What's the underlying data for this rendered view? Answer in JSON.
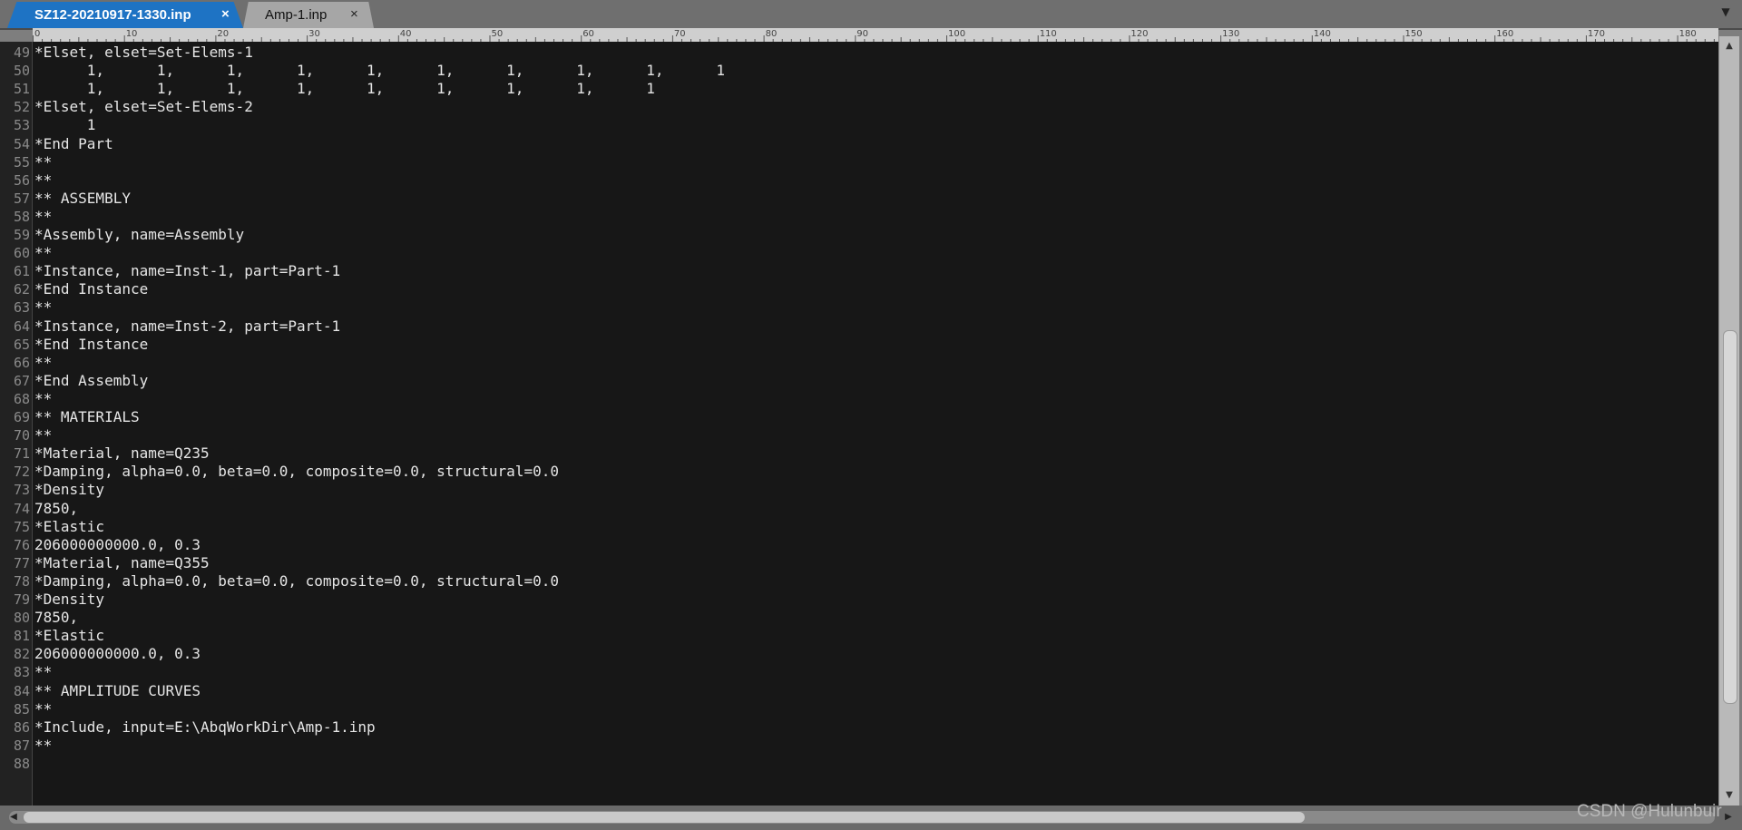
{
  "tabs": [
    {
      "label": "SZ12-20210917-1330.inp",
      "close": "×",
      "active": true
    },
    {
      "label": "Amp-1.inp",
      "close": "×",
      "active": false
    }
  ],
  "tab_menu_icon": "chevron-down-icon",
  "ruler": {
    "labels": [
      "0",
      "10",
      "20",
      "30",
      "40",
      "50",
      "60",
      "70",
      "80",
      "90",
      "100",
      "110",
      "120",
      "130",
      "140",
      "150",
      "160",
      "170",
      "180"
    ]
  },
  "lines": [
    {
      "n": "49",
      "text": "*Elset, elset=Set-Elems-1"
    },
    {
      "n": "50",
      "text": "      1,      1,      1,      1,      1,      1,      1,      1,      1,      1"
    },
    {
      "n": "51",
      "text": "      1,      1,      1,      1,      1,      1,      1,      1,      1"
    },
    {
      "n": "52",
      "text": "*Elset, elset=Set-Elems-2"
    },
    {
      "n": "53",
      "text": "      1"
    },
    {
      "n": "54",
      "text": "*End Part"
    },
    {
      "n": "55",
      "text": "**"
    },
    {
      "n": "56",
      "text": "**"
    },
    {
      "n": "57",
      "text": "** ASSEMBLY"
    },
    {
      "n": "58",
      "text": "**"
    },
    {
      "n": "59",
      "text": "*Assembly, name=Assembly"
    },
    {
      "n": "60",
      "text": "**"
    },
    {
      "n": "61",
      "text": "*Instance, name=Inst-1, part=Part-1"
    },
    {
      "n": "62",
      "text": "*End Instance"
    },
    {
      "n": "63",
      "text": "**"
    },
    {
      "n": "64",
      "text": "*Instance, name=Inst-2, part=Part-1"
    },
    {
      "n": "65",
      "text": "*End Instance"
    },
    {
      "n": "66",
      "text": "**"
    },
    {
      "n": "67",
      "text": "*End Assembly"
    },
    {
      "n": "68",
      "text": "**"
    },
    {
      "n": "69",
      "text": "** MATERIALS"
    },
    {
      "n": "70",
      "text": "**"
    },
    {
      "n": "71",
      "text": "*Material, name=Q235"
    },
    {
      "n": "72",
      "text": "*Damping, alpha=0.0, beta=0.0, composite=0.0, structural=0.0"
    },
    {
      "n": "73",
      "text": "*Density"
    },
    {
      "n": "74",
      "text": "7850,"
    },
    {
      "n": "75",
      "text": "*Elastic"
    },
    {
      "n": "76",
      "text": "206000000000.0, 0.3"
    },
    {
      "n": "77",
      "text": "*Material, name=Q355"
    },
    {
      "n": "78",
      "text": "*Damping, alpha=0.0, beta=0.0, composite=0.0, structural=0.0"
    },
    {
      "n": "79",
      "text": "*Density"
    },
    {
      "n": "80",
      "text": "7850,"
    },
    {
      "n": "81",
      "text": "*Elastic"
    },
    {
      "n": "82",
      "text": "206000000000.0, 0.3"
    },
    {
      "n": "83",
      "text": "**"
    },
    {
      "n": "84",
      "text": "** AMPLITUDE CURVES"
    },
    {
      "n": "85",
      "text": "**"
    },
    {
      "n": "86",
      "text": "*Include, input=E:\\AbqWorkDir\\Amp-1.inp"
    },
    {
      "n": "87",
      "text": "**"
    },
    {
      "n": "88",
      "text": ""
    }
  ],
  "scrollbar": {
    "up_icon": "▲",
    "down_icon": "▼",
    "left_icon": "◀",
    "right_icon": "▶"
  },
  "watermark": "CSDN @Hulunbuir"
}
